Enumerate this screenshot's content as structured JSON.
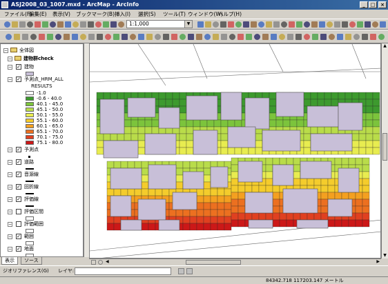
{
  "window": {
    "title": "ASJ2008_03_1007.mxd - ArcMap - ArcInfo"
  },
  "menu": [
    "ファイル(F)",
    "編集(E)",
    "表示(V)",
    "ブックマーク(B)",
    "挿入(I)",
    "選択(S)",
    "ツール(T)",
    "ウィンドウ(W)",
    "ヘルプ(H)"
  ],
  "toolbar": {
    "scale": "1:1,000"
  },
  "toc": {
    "root": "全体図",
    "group": "建物群check",
    "layers": [
      {
        "name": "建物",
        "checked": true,
        "swatch": "#c8bfd8"
      },
      {
        "name": "予測点_HRM_ALL",
        "checked": true,
        "field": "RESULTS"
      },
      {
        "name": "予測点",
        "checked": true
      },
      {
        "name": "道路",
        "checked": true
      },
      {
        "name": "音源線",
        "checked": true
      },
      {
        "name": "回折線",
        "checked": true
      },
      {
        "name": "評価線",
        "checked": true
      },
      {
        "name": "評価区間",
        "checked": false
      },
      {
        "name": "評価範囲",
        "checked": false
      },
      {
        "name": "範囲",
        "checked": true
      },
      {
        "name": "地面",
        "checked": true
      }
    ],
    "legend": [
      {
        "label": "-1.0",
        "color": "#ffffff"
      },
      {
        "label": "-0.6 - 40.0",
        "color": "#3d9a2e"
      },
      {
        "label": "40.1 - 45.0",
        "color": "#7cc43c"
      },
      {
        "label": "45.1 - 50.0",
        "color": "#b9dc4a"
      },
      {
        "label": "50.1 - 55.0",
        "color": "#e8ec50"
      },
      {
        "label": "55.1 - 60.0",
        "color": "#f4cc2c"
      },
      {
        "label": "60.1 - 65.0",
        "color": "#f4a020"
      },
      {
        "label": "65.1 - 70.0",
        "color": "#ec7020"
      },
      {
        "label": "70.1 - 75.0",
        "color": "#e04020"
      },
      {
        "label": "75.1 - 80.0",
        "color": "#cc1818"
      }
    ],
    "tabs": [
      "表示",
      "ソース"
    ]
  },
  "drawbar": {
    "label": "ジオリファレンス(G)",
    "layer_label": "レイヤ:"
  },
  "status": {
    "coords": "84342.718  117203.147 メートル"
  },
  "colors": {
    "building": "#c8bfd8",
    "building_edge": "#555555"
  }
}
